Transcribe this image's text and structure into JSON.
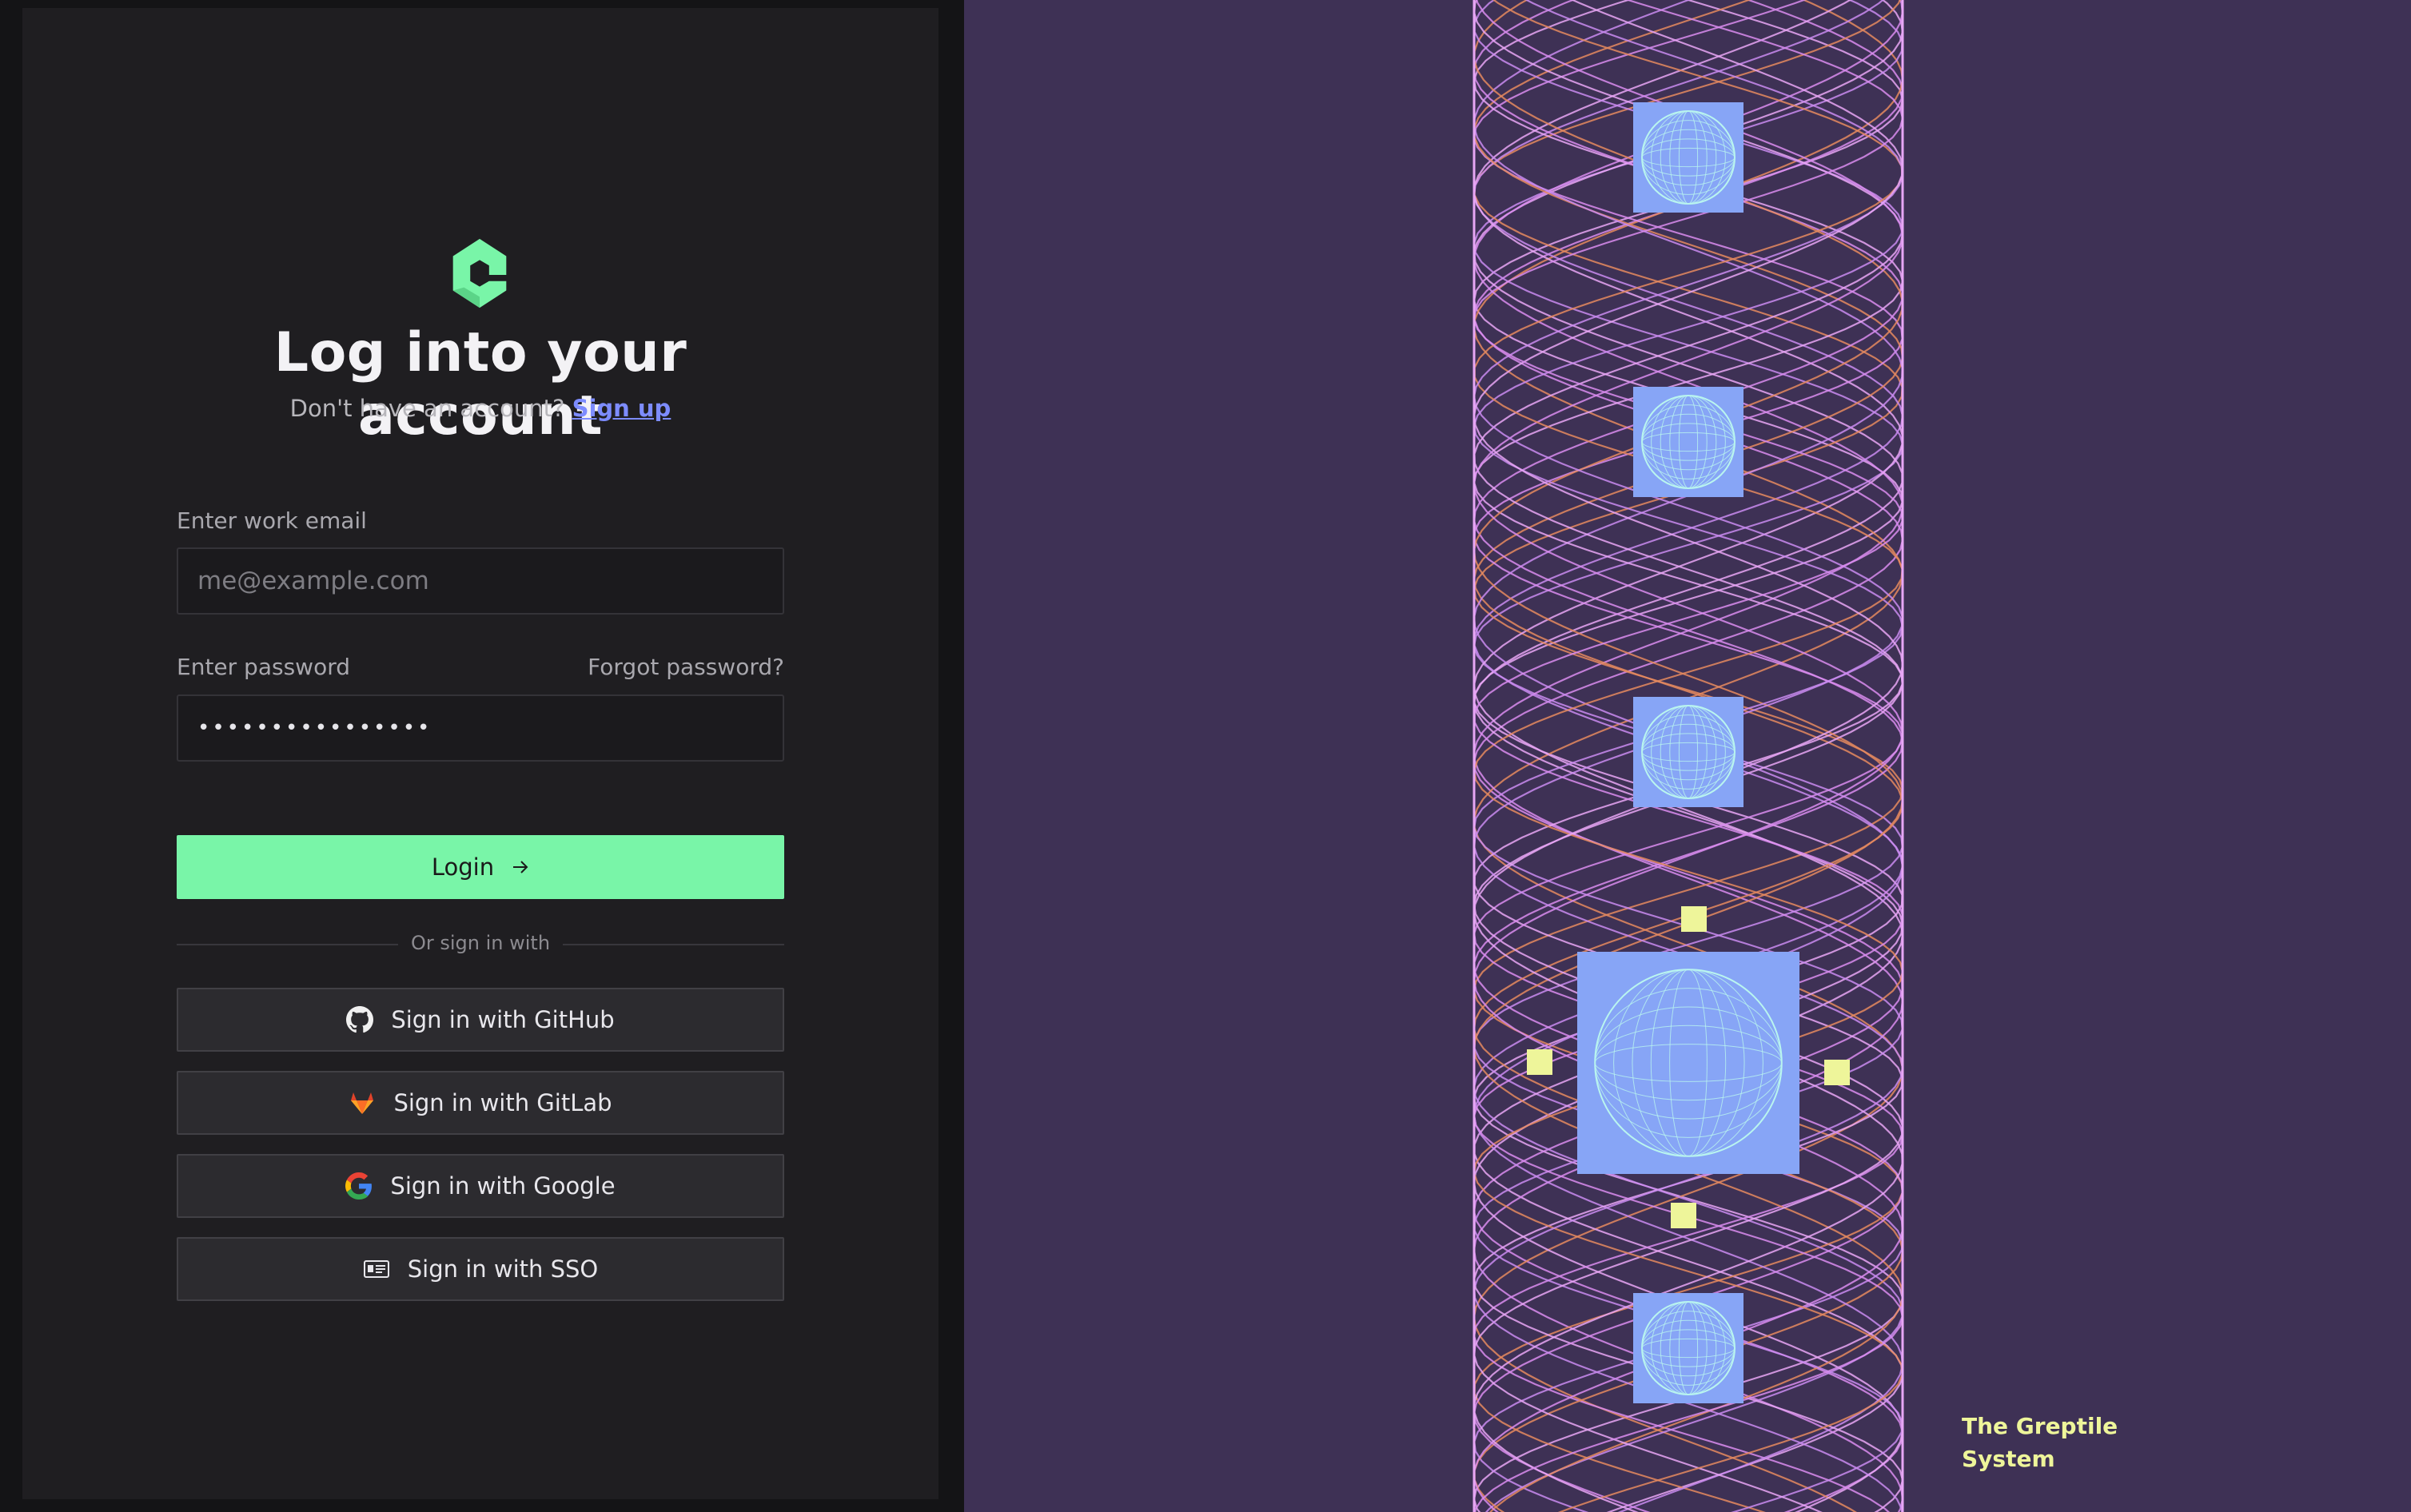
{
  "login": {
    "title": "Log into your account",
    "signup_prompt": "Don't have an account?",
    "signup_link": "Sign up",
    "email_label": "Enter work email",
    "email_placeholder": "me@example.com",
    "password_label": "Enter password",
    "password_value": "••••••••••••••••",
    "forgot_link": "Forgot password?",
    "login_button": "Login",
    "divider_text": "Or sign in with",
    "social_buttons": [
      {
        "label": "Sign in with GitHub",
        "icon": "github-icon"
      },
      {
        "label": "Sign in with GitLab",
        "icon": "gitlab-icon"
      },
      {
        "label": "Sign in with Google",
        "icon": "google-icon"
      },
      {
        "label": "Sign in with SSO",
        "icon": "sso-card-icon"
      }
    ]
  },
  "art_panel": {
    "caption_line1": "The Greptile",
    "caption_line2": "System"
  },
  "colors": {
    "accent": "#79f5a8",
    "link": "#7d8cff",
    "art_background": "#3e3155",
    "tile": "#87a5f6",
    "marker": "#eef59a"
  }
}
